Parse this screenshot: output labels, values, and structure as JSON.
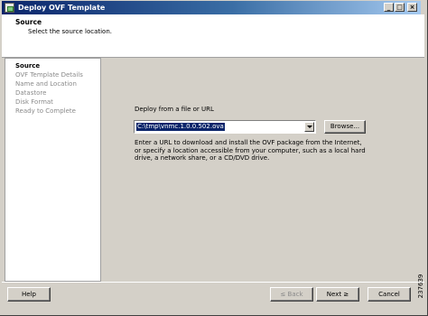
{
  "window": {
    "title": "Deploy OVF Template",
    "caption_buttons": [
      "_",
      "□",
      "×"
    ]
  },
  "header": {
    "title": "Source",
    "subtitle": "Select the source location."
  },
  "steps": [
    {
      "label": "Source",
      "active": true
    },
    {
      "label": "OVF Template Details",
      "active": false
    },
    {
      "label": "Name and Location",
      "active": false
    },
    {
      "label": "Datastore",
      "active": false
    },
    {
      "label": "Disk Format",
      "active": false
    },
    {
      "label": "Ready to Complete",
      "active": false
    }
  ],
  "source": {
    "label": "Deploy from a file or URL",
    "value": "C:\\tmp\\vnmc.1.0.0.502.ova",
    "browse_label": "Browse...",
    "description": "Enter a URL to download and install the OVF package from the Internet, or specify a location accessible from your computer, such as a local hard drive, a network share, or a CD/DVD drive."
  },
  "footer": {
    "help_label": "Help",
    "back_label": "≤ Back",
    "next_label": "Next ≥",
    "cancel_label": "Cancel"
  },
  "figure_id": "237639"
}
